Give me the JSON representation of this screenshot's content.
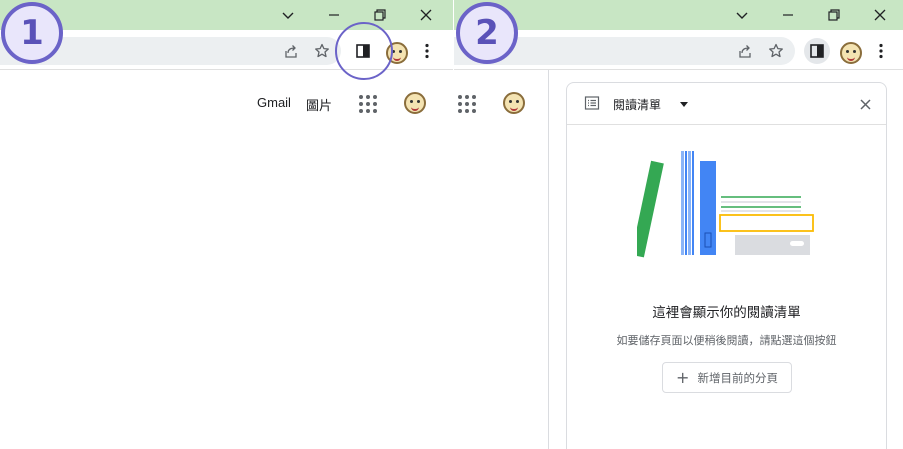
{
  "steps": [
    "1",
    "2"
  ],
  "gbar": {
    "gmail": "Gmail",
    "images": "圖片"
  },
  "reading_list": {
    "title": "閱讀清單",
    "empty_title": "這裡會顯示你的閱讀清單",
    "empty_description": "如要儲存頁面以便稍後閱讀，請點選這個按鈕",
    "add_button_label": "新增目前的分頁",
    "add_button_icon": "+"
  },
  "colors": {
    "title_bar": "#c8e6c4",
    "highlight": "#6b63c8",
    "book_green": "#34a853",
    "book_blue": "#4285f4",
    "book_light_blue": "#8ab4f8",
    "page_yellow": "#fbbc04",
    "card_gray": "#dadce0"
  },
  "icons": {
    "share": "share-icon",
    "bookmark": "star-icon",
    "side_panel": "side-panel-icon",
    "menu": "kebab-menu-icon",
    "apps": "google-apps-icon",
    "minimize": "minimize-icon",
    "restore": "restore-icon",
    "close": "close-icon",
    "tab_search": "chevron-down-icon",
    "reading_list": "list-icon"
  }
}
